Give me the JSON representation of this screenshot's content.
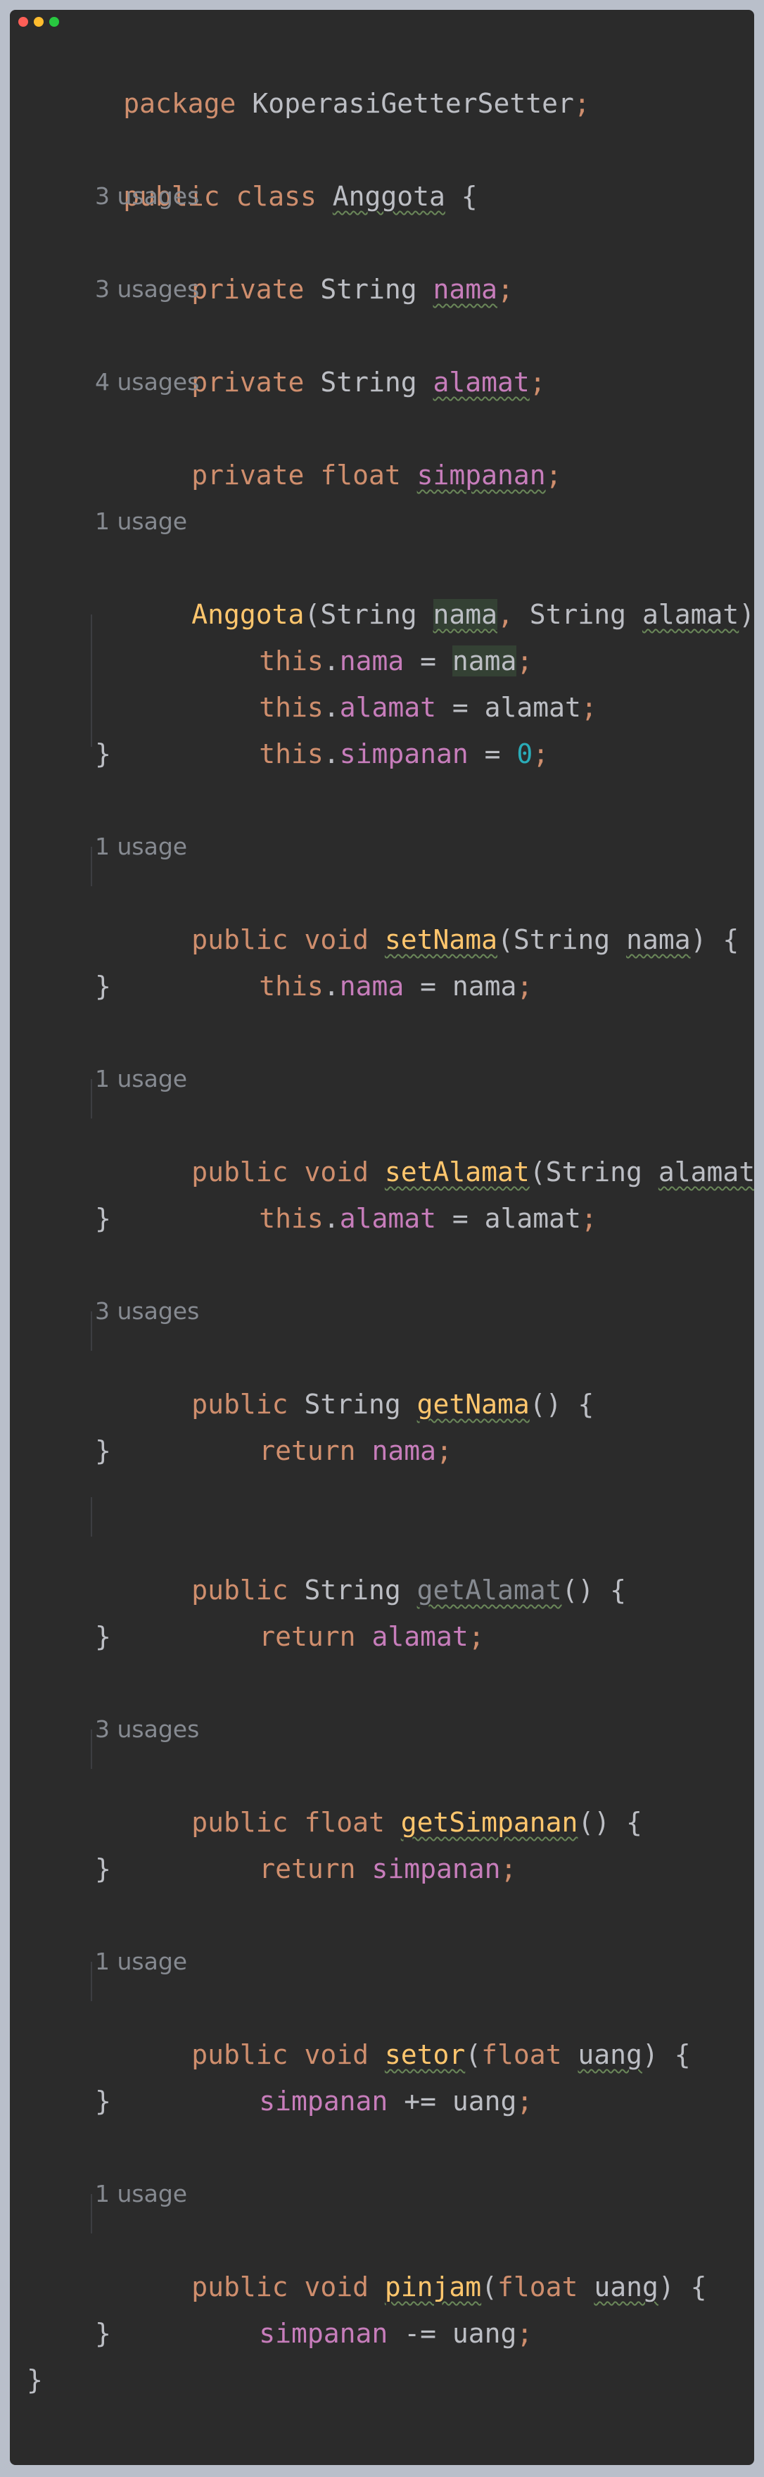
{
  "window": {
    "controls": [
      "close-dot",
      "minimize-dot",
      "zoom-dot"
    ],
    "colors": {
      "background": "#2b2b2b",
      "keyword": "#cf8e6d",
      "field": "#c77dbb",
      "method": "#ffc66d",
      "number": "#2aacb8",
      "text": "#bcbec4",
      "hint": "#868a91"
    }
  },
  "code": {
    "package_kw": "package",
    "package_name": "KoperasiGetterSetter",
    "semi": ";",
    "public": "public",
    "private": "private",
    "class_kw": "class",
    "void": "void",
    "float": "float",
    "string": "String",
    "this": "this",
    "return": "return",
    "class_name": "Anggota",
    "open_brace": " {",
    "close_brace": "}",
    "field_nama": "nama",
    "field_alamat": "alamat",
    "field_simpanan": "simpanan",
    "zero": "0",
    "uang": "uang",
    "m_setNama": "setNama",
    "m_setAlamat": "setAlamat",
    "m_getNama": "getNama",
    "m_getAlamat": "getAlamat",
    "m_getSimpanan": "getSimpanan",
    "m_setor": "setor",
    "m_pinjam": "pinjam",
    "op_assign": " = ",
    "op_plus": " += ",
    "op_minus": " -= ",
    "comma": ",",
    "dot": ".",
    "lparen": "(",
    "rparen": ")",
    "empty_parens": "()",
    "space": " "
  },
  "hints": {
    "h_nama": "3 usages",
    "h_alamat": "3 usages",
    "h_simpanan": "4 usages",
    "h_ctor": "1 usage",
    "h_setNama": "1 usage",
    "h_setAlamat": "1 usage",
    "h_getNama": "3 usages",
    "h_getSimpanan": "3 usages",
    "h_setor": "1 usage",
    "h_pinjam": "1 usage"
  }
}
